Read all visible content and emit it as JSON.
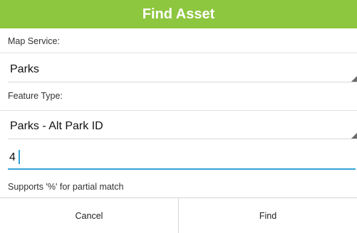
{
  "dialog": {
    "title": "Find Asset"
  },
  "map_service": {
    "label": "Map Service:",
    "selected": "Parks"
  },
  "feature_type": {
    "label": "Feature Type:",
    "selected": "Parks - Alt Park ID"
  },
  "search": {
    "value": "4"
  },
  "hint": "Supports '%' for partial match",
  "buttons": {
    "cancel_label": "Cancel",
    "find_label": "Find"
  },
  "colors": {
    "title_bar": "#8dc63f",
    "input_focus": "#33a3d6"
  },
  "icons": {
    "spinner_arrow": "dropdown-triangle-icon"
  }
}
